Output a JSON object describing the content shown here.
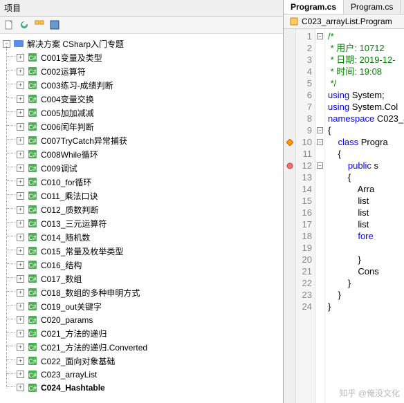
{
  "panel": {
    "title": "项目"
  },
  "toolbar": {
    "icons": [
      "doc-icon",
      "refresh-icon",
      "collapse-icon",
      "properties-icon"
    ]
  },
  "tree": {
    "root": "解决方案 CSharp入门专题",
    "items": [
      "C001变量及类型",
      "C002运算符",
      "C003练习-成绩判断",
      "C004变量交换",
      "C005加加减减",
      "C006闰年判断",
      "C007TryCatch异常捕获",
      "C008While循环",
      "C009调试",
      "C010_for循环",
      "C011_乘法口诀",
      "C012_质数判断",
      "C013_三元运算符",
      "C014_随机数",
      "C015_常量及枚举类型",
      "C016_结构",
      "C017_数组",
      "C018_数组的多种申明方式",
      "C019_out关键字",
      "C020_params",
      "C021_方法的递归",
      "C021_方法的递归.Converted",
      "C022_面向对象基础",
      "C023_arrayList"
    ],
    "bold_item": "C024_Hashtable"
  },
  "tabs": {
    "active": "Program.cs",
    "other": "Program.cs"
  },
  "subtab": {
    "label": "C023_arrayList.Program"
  },
  "code": {
    "lines": [
      {
        "n": 1,
        "marker": "",
        "fold": "box",
        "text": "/*",
        "cls": "c-comment"
      },
      {
        "n": 2,
        "marker": "",
        "fold": "",
        "text": " * 用户: 10712",
        "cls": "c-comment"
      },
      {
        "n": 3,
        "marker": "",
        "fold": "",
        "text": " * 日期: 2019-12-",
        "cls": "c-comment"
      },
      {
        "n": 4,
        "marker": "",
        "fold": "",
        "text": " * 时间: 19:08",
        "cls": "c-comment"
      },
      {
        "n": 5,
        "marker": "",
        "fold": "",
        "text": " */",
        "cls": "c-comment"
      },
      {
        "n": 6,
        "marker": "",
        "fold": "",
        "html": "<span class='c-keyword'>using</span> System;"
      },
      {
        "n": 7,
        "marker": "",
        "fold": "",
        "html": "<span class='c-keyword'>using</span> System.Col"
      },
      {
        "n": 8,
        "marker": "",
        "fold": "",
        "html": "<span class='c-keyword'>namespace</span> C023_a"
      },
      {
        "n": 9,
        "marker": "",
        "fold": "box",
        "text": "{",
        "cls": ""
      },
      {
        "n": 10,
        "marker": "diamond",
        "fold": "box",
        "html": "    <span class='c-keyword'>class</span> Progra"
      },
      {
        "n": 11,
        "marker": "",
        "fold": "",
        "text": "    {",
        "cls": ""
      },
      {
        "n": 12,
        "marker": "dot",
        "fold": "box",
        "html": "        <span class='c-keyword'>public</span> s"
      },
      {
        "n": 13,
        "marker": "",
        "fold": "",
        "text": "        {",
        "cls": ""
      },
      {
        "n": 14,
        "marker": "",
        "fold": "",
        "text": "            Arra",
        "cls": ""
      },
      {
        "n": 15,
        "marker": "",
        "fold": "",
        "text": "            list",
        "cls": ""
      },
      {
        "n": 16,
        "marker": "",
        "fold": "",
        "text": "            list",
        "cls": ""
      },
      {
        "n": 17,
        "marker": "",
        "fold": "",
        "text": "            list",
        "cls": ""
      },
      {
        "n": 18,
        "marker": "",
        "fold": "",
        "html": "            <span class='c-keyword'>fore</span>"
      },
      {
        "n": 19,
        "marker": "",
        "fold": "",
        "text": "",
        "cls": ""
      },
      {
        "n": 20,
        "marker": "",
        "fold": "",
        "text": "            }",
        "cls": ""
      },
      {
        "n": 21,
        "marker": "",
        "fold": "",
        "text": "            Cons",
        "cls": ""
      },
      {
        "n": 22,
        "marker": "",
        "fold": "",
        "text": "        }",
        "cls": ""
      },
      {
        "n": 23,
        "marker": "",
        "fold": "",
        "text": "    }",
        "cls": ""
      },
      {
        "n": 24,
        "marker": "",
        "fold": "",
        "text": "}",
        "cls": ""
      }
    ]
  },
  "watermark": "知乎 @俺没文化"
}
